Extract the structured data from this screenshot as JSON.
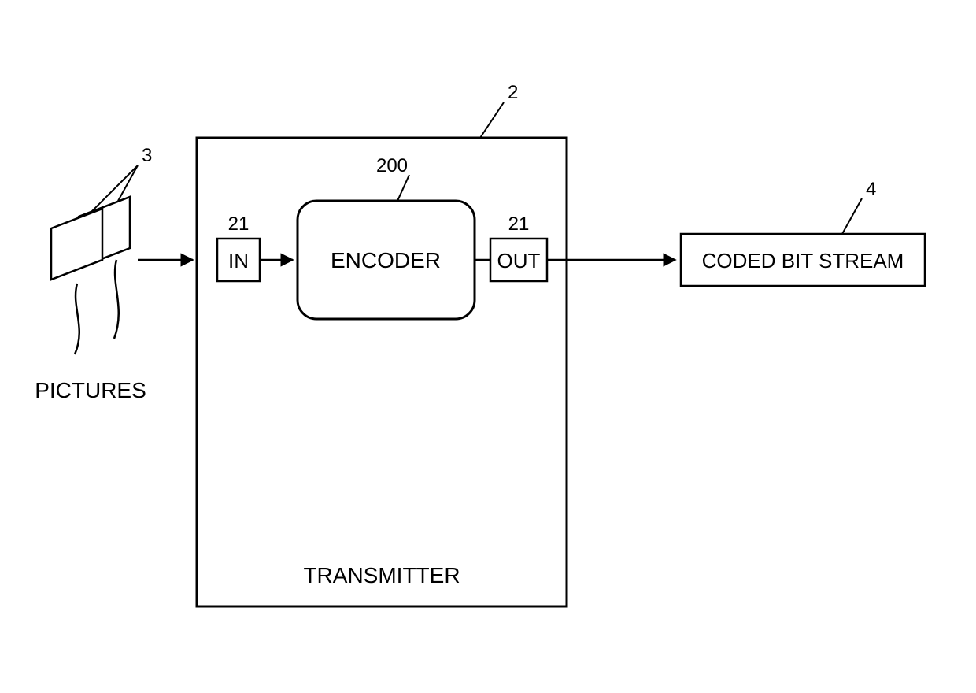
{
  "diagram": {
    "pictures_label": "PICTURES",
    "transmitter_label": "TRANSMITTER",
    "in_label": "IN",
    "out_label": "OUT",
    "encoder_label": "ENCODER",
    "coded_stream_label": "CODED BIT STREAM",
    "ref": {
      "pictures": "3",
      "transmitter": "2",
      "in": "21",
      "out": "21",
      "encoder": "200",
      "coded_stream": "4"
    }
  }
}
